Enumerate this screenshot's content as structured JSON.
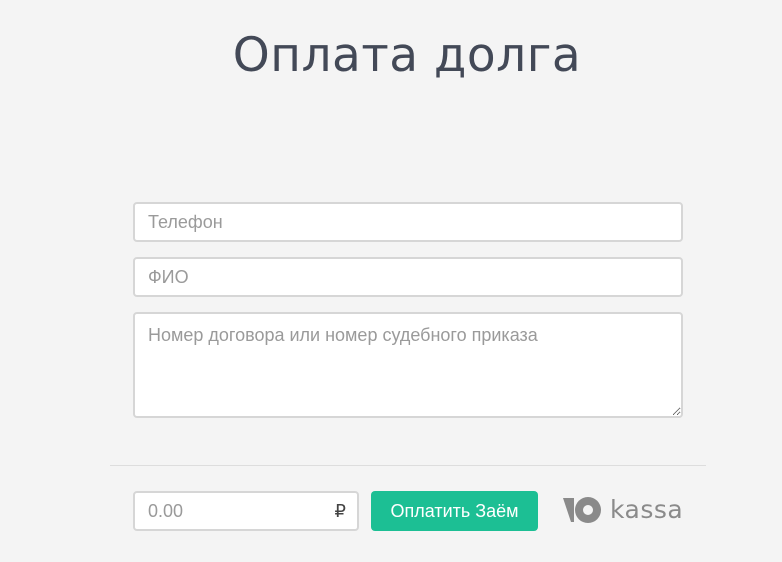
{
  "header": {
    "title": "Оплата долга"
  },
  "form": {
    "phone_placeholder": "Телефон",
    "fio_placeholder": "ФИО",
    "contract_placeholder": "Номер договора или номер судебного приказа",
    "amount_placeholder": "0.00",
    "currency_symbol": "₽",
    "pay_button_label": "Оплатить Заём"
  },
  "logo": {
    "text": "kassa",
    "icon": "yoomoney-icon",
    "color": "#8a8a8a"
  },
  "colors": {
    "background": "#f4f4f4",
    "accent": "#1cbf94",
    "title": "#434957"
  }
}
